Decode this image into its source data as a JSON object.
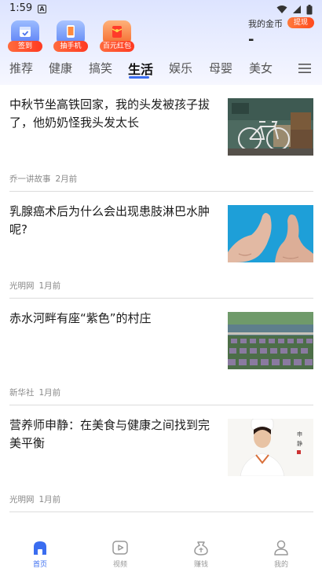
{
  "status": {
    "time": "1:59",
    "notification_letter": "A"
  },
  "promos": [
    {
      "label": "签到",
      "icon": "calendar-icon"
    },
    {
      "label": "抽手机",
      "icon": "phone-icon"
    },
    {
      "label": "百元红包",
      "icon": "red-envelope-icon"
    }
  ],
  "coins": {
    "label": "我的金币",
    "withdraw": "提现",
    "value": "-"
  },
  "tabs": [
    "推荐",
    "健康",
    "搞笑",
    "生活",
    "娱乐",
    "母婴",
    "美女"
  ],
  "active_tab": "生活",
  "articles": [
    {
      "title": "中秋节坐高铁回家，我的头发被孩子拔了，他奶奶怪我头发太长",
      "source": "乔一讲故事",
      "time": "2月前"
    },
    {
      "title": "乳腺癌术后为什么会出现患肢淋巴水肿呢?",
      "source": "光明网",
      "time": "1月前"
    },
    {
      "title": "赤水河畔有座“紫色”的村庄",
      "source": "新华社",
      "time": "1月前"
    },
    {
      "title": "营养师申静：在美食与健康之间找到完美平衡",
      "source": "光明网",
      "time": "1月前"
    }
  ],
  "bottom_nav": [
    {
      "label": "首页",
      "icon": "home-icon",
      "active": true
    },
    {
      "label": "视频",
      "icon": "video-icon",
      "active": false
    },
    {
      "label": "赚钱",
      "icon": "earn-icon",
      "active": false
    },
    {
      "label": "我的",
      "icon": "profile-icon",
      "active": false
    }
  ],
  "colors": {
    "accent": "#3a6df0",
    "promo_badge": "#ff4a1e",
    "header_bg": "#dde4ff"
  }
}
